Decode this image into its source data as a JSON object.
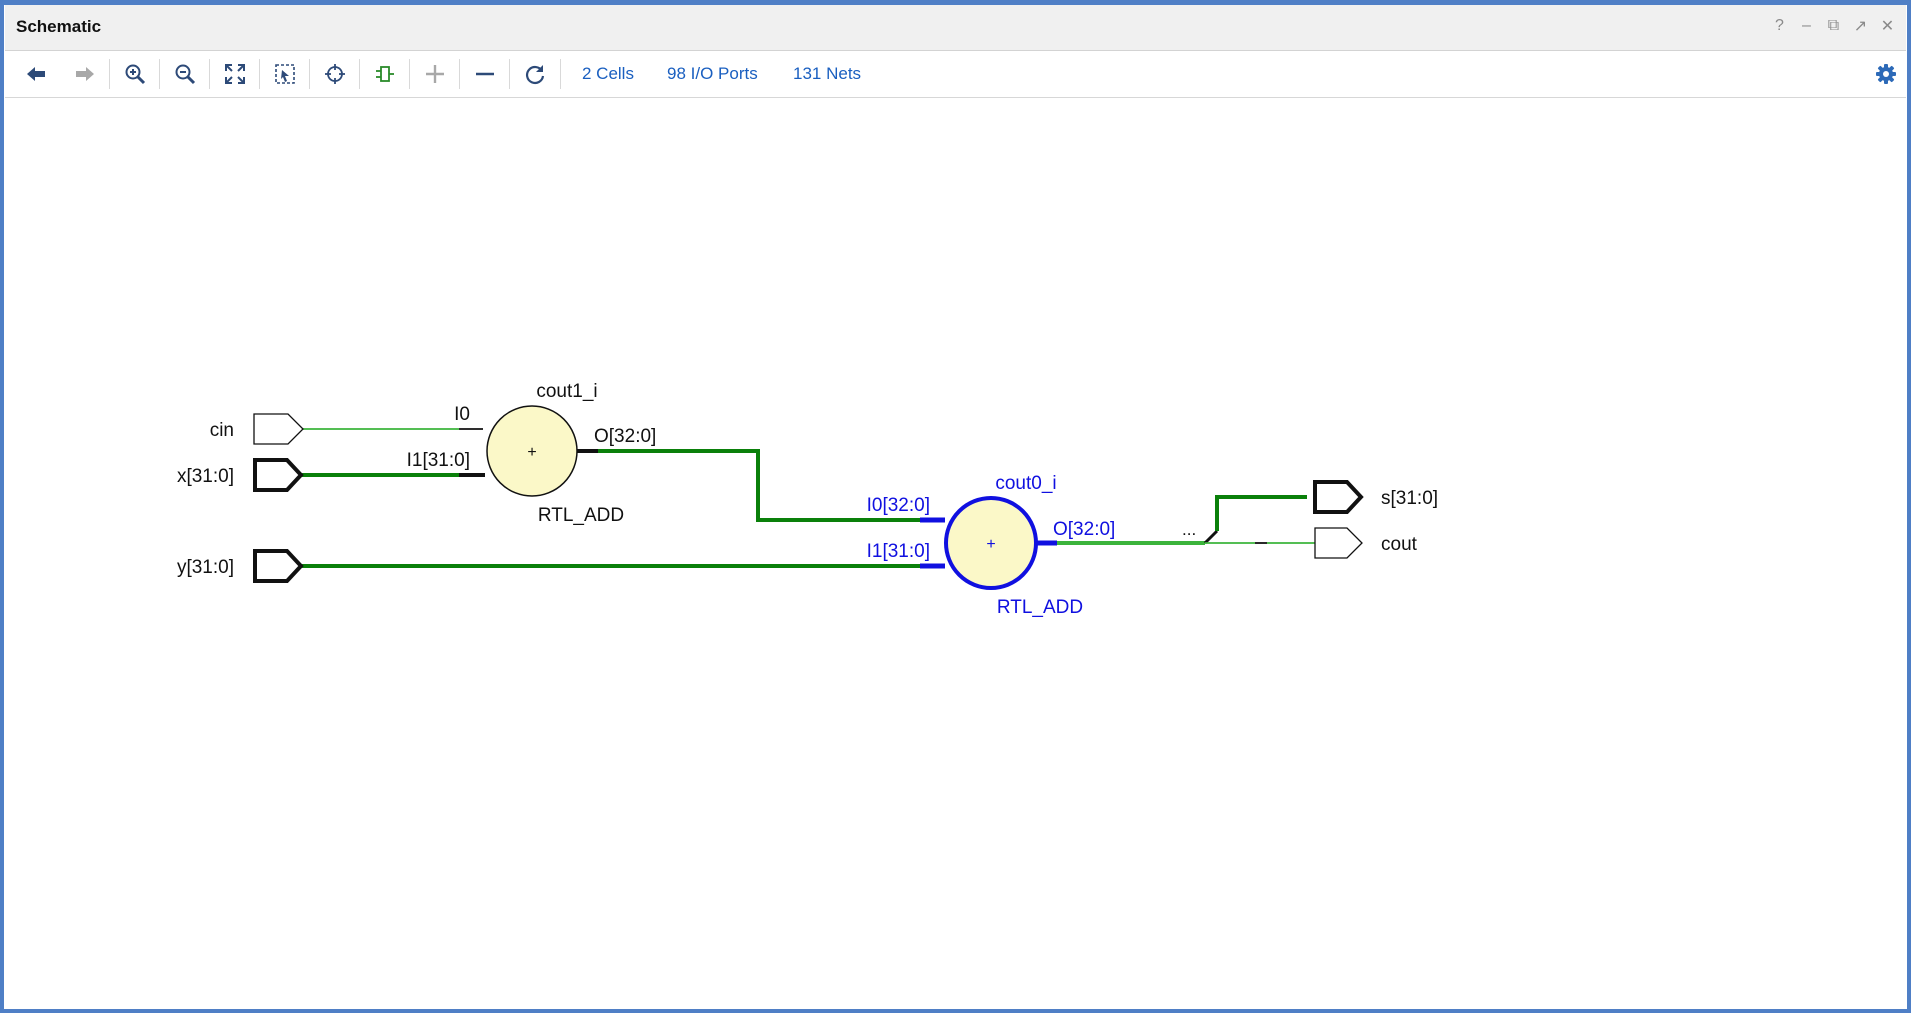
{
  "window": {
    "title": "Schematic",
    "controls": {
      "help": "?",
      "minimize": "–",
      "restore": "⧉",
      "maximize": "↗",
      "close": "✕"
    }
  },
  "toolbar": {
    "buttons": [
      {
        "name": "back-button",
        "icon": "arrow-left-icon"
      },
      {
        "name": "forward-button",
        "icon": "arrow-right-icon"
      },
      {
        "name": "zoom-in-button",
        "icon": "zoom-in-icon"
      },
      {
        "name": "zoom-out-button",
        "icon": "zoom-out-icon"
      },
      {
        "name": "zoom-fit-button",
        "icon": "fit-icon"
      },
      {
        "name": "zoom-area-button",
        "icon": "zoom-area-icon"
      },
      {
        "name": "autofit-selection-button",
        "icon": "crosshair-icon"
      },
      {
        "name": "regenerate-button",
        "icon": "cell-icon"
      },
      {
        "name": "expand-button",
        "icon": "plus-icon"
      },
      {
        "name": "collapse-button",
        "icon": "minus-icon"
      },
      {
        "name": "refresh-button",
        "icon": "refresh-icon"
      }
    ],
    "cells_link": "2 Cells",
    "ports_link": "98 I/O Ports",
    "nets_link": "131 Nets",
    "settings_icon": "gear-icon",
    "accent": "#1a5fc0"
  },
  "schematic": {
    "colors": {
      "net_green": "#0a800a",
      "net_green_light": "#3cb43c",
      "selected_blue": "#1010e0",
      "cell_fill": "#fbf8c8",
      "port_stroke": "#111111"
    },
    "input_ports": {
      "cin": "cin",
      "x": "x[31:0]",
      "y": "y[31:0]"
    },
    "output_ports": {
      "s": "s[31:0]",
      "cout": "cout"
    },
    "cell1": {
      "instance": "cout1_i",
      "type": "RTL_ADD",
      "symbol": "+",
      "pin_i0": "I0",
      "pin_i1": "I1[31:0]",
      "pin_o": "O[32:0]"
    },
    "cell0": {
      "instance": "cout0_i",
      "type": "RTL_ADD",
      "symbol": "+",
      "pin_i0": "I0[32:0]",
      "pin_i1": "I1[31:0]",
      "pin_o": "O[32:0]"
    },
    "bus_ripper": "..."
  }
}
